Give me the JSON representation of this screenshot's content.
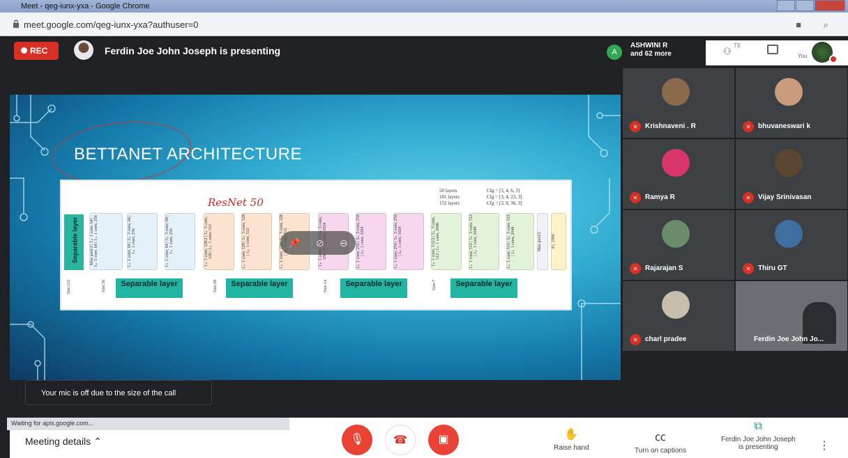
{
  "browser": {
    "title": "Meet - qeg-iunx-yxa - Google Chrome",
    "url": "meet.google.com/qeg-iunx-yxa?authuser=0"
  },
  "meet_header": {
    "rec_label": "REC",
    "presenting_text": "Ferdin Joe John Joseph is presenting",
    "participant_avatar_letter": "A",
    "participant_name": "ASHWINI R",
    "participant_more": "and 62 more",
    "people_count": "73",
    "you_label": "You"
  },
  "slide": {
    "title": "BETTANET ARCHITECTURE",
    "annotation": "ResNet 50",
    "separable_side": "Separable layer",
    "cfg_layers": [
      "50 layers",
      "101 layers",
      "152 layers"
    ],
    "cfg_values": [
      "Cfg = [3, 4, 6, 3]",
      "Cfg = [3, 4, 23, 3]",
      "Cfg = [3, 8, 36, 3]"
    ],
    "separable_layers": [
      "Separable layer",
      "Separable layer",
      "Separable layer",
      "Separable layer"
    ],
    "sizes": [
      "Size:112",
      "Size:56",
      "Size:28",
      "Size:14",
      "Size:7"
    ],
    "blocks": [
      {
        "text": "Max pool/2 | 1×1 conv, 64 | 3×3 conv, 64 | 1×1 conv, 256",
        "color": "#e4f1f8"
      },
      {
        "text": "1×1 conv, 64 | 3×3 conv, 64 | 1×1 conv, 256",
        "color": "#e4f1f8"
      },
      {
        "text": "1×1 conv, 64 | 3×3 conv, 64 | 1×1 conv, 256",
        "color": "#e4f1f8"
      },
      {
        "text": "1×1 conv, 128/2 | 3×3 conv, 128 | 1×1 conv, 512",
        "color": "#fce3d0"
      },
      {
        "text": "1×1 conv, 128 | 3×3 conv, 128 | 1×1 conv, 512",
        "color": "#fce3d0"
      },
      {
        "text": "1×1 conv, 128 | 3×3 conv, 128 | 1×1 conv, 512",
        "color": "#fce3d0"
      },
      {
        "text": "1×1 conv, 256/2 | 3×3 conv, 256 | 1×1 conv, 1024",
        "color": "#f6d7ee"
      },
      {
        "text": "1×1 conv, 256 | 3×3 conv, 256 | 1×1 conv, 1024",
        "color": "#f6d7ee"
      },
      {
        "text": "1×1 conv, 256 | 3×3 conv, 256 | 1×1 conv, 1024",
        "color": "#f6d7ee"
      },
      {
        "text": "1×1 conv, 512/2 | 3×3 conv, 512 | 1×1 conv, 2048",
        "color": "#e2f3d9"
      },
      {
        "text": "1×1 conv, 512 | 3×3 conv, 512 | 1×1 conv, 2048",
        "color": "#e2f3d9"
      },
      {
        "text": "1×1 conv, 512 | 3×3 conv, 512 | 1×1 conv, 2048",
        "color": "#e2f3d9"
      },
      {
        "text": "Max pool/2",
        "color": "#eef2f6"
      },
      {
        "text": "Fc, 1000",
        "color": "#fbf2c9"
      }
    ]
  },
  "toast": "Your mic is off due to the size of the call",
  "participants": [
    {
      "name": "Krishnaveni . R",
      "avatar_color": "#8a6a4a"
    },
    {
      "name": "bhuvaneswari k",
      "avatar_color": "#c89c7c"
    },
    {
      "name": "Ramya R",
      "avatar_color": "#d8356a"
    },
    {
      "name": "Vijay Srinivasan",
      "avatar_color": "#5b4634"
    },
    {
      "name": "Rajarajan S",
      "avatar_color": "#6a8c6a"
    },
    {
      "name": "Thiru GT",
      "avatar_color": "#3e6fa0"
    },
    {
      "name": "charl pradee",
      "avatar_color": "#c7bfae"
    },
    {
      "name": "Ferdin Joe John Jo...",
      "avatar_color": "#4a4e54"
    }
  ],
  "bottom": {
    "meeting_details": "Meeting details",
    "raise_hand": "Raise hand",
    "captions": "Turn on captions",
    "presenting_line1": "Ferdin Joe John Joseph",
    "presenting_line2": "is presenting"
  },
  "status_bar": "Waiting for apis.google.com..."
}
